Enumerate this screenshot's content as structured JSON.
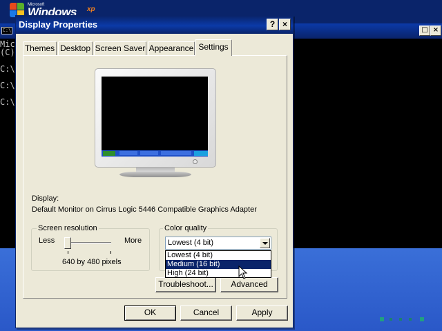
{
  "desktop": {
    "logo": {
      "company": "Microsoft",
      "product": "Windows",
      "version": "xp"
    },
    "console": {
      "lines": [
        "Mic",
        "(C)",
        "",
        "C:\\",
        "",
        "C:\\",
        "",
        "C:\\"
      ],
      "buttons": {
        "maximize": "□",
        "close": "×"
      }
    }
  },
  "dialog": {
    "title": "Display Properties",
    "title_buttons": {
      "help": "?",
      "close": "×"
    },
    "tabs": [
      "Themes",
      "Desktop",
      "Screen Saver",
      "Appearance",
      "Settings"
    ],
    "active_tab": "Settings",
    "display_label": "Display:",
    "display_value": "Default Monitor on Cirrus Logic 5446 Compatible Graphics Adapter",
    "screen_resolution": {
      "title": "Screen resolution",
      "less_label": "Less",
      "more_label": "More",
      "value_text": "640 by 480 pixels",
      "slider_position": 0
    },
    "color_quality": {
      "title": "Color quality",
      "selected": "Lowest (4 bit)",
      "options": [
        "Lowest (4 bit)",
        "Medium (16 bit)",
        "High (24 bit)"
      ],
      "highlighted_option": "Medium (16 bit)"
    },
    "buttons": {
      "troubleshoot": "Troubleshoot...",
      "advanced": "Advanced",
      "ok": "OK",
      "cancel": "Cancel",
      "apply": "Apply"
    }
  },
  "colors": {
    "titlebar": "#0A246A",
    "dialog_face": "#ECE9D8",
    "desktop_blue": "#245EDC",
    "selection": "#0A246A"
  }
}
